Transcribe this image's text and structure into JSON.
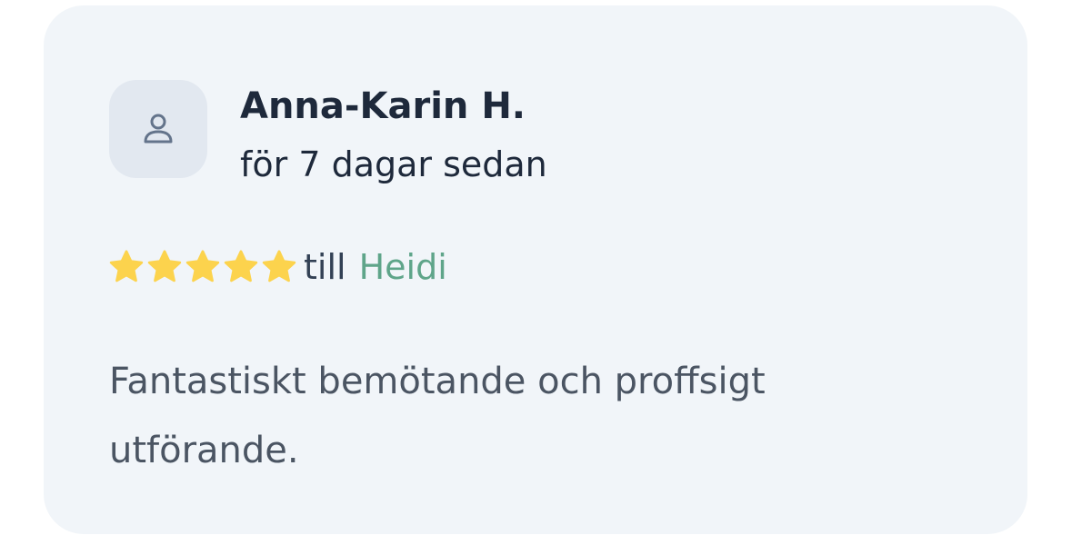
{
  "review": {
    "author": "Anna-Karin H.",
    "time_ago": "för 7 dagar sedan",
    "rating": 5,
    "rating_max": 5,
    "till_label": "till",
    "recipient": "Heidi",
    "text": "Fantastiskt bemötande och proffsigt utförande.",
    "avatar_icon": "user-icon",
    "star_icon": "star-icon"
  },
  "colors": {
    "card_background": "#f1f5f9",
    "avatar_background": "#e2e8f0",
    "star": "#fcd34d",
    "recipient_link": "#5fa58a",
    "name_text": "#1e293b",
    "body_text": "#4b5563"
  }
}
